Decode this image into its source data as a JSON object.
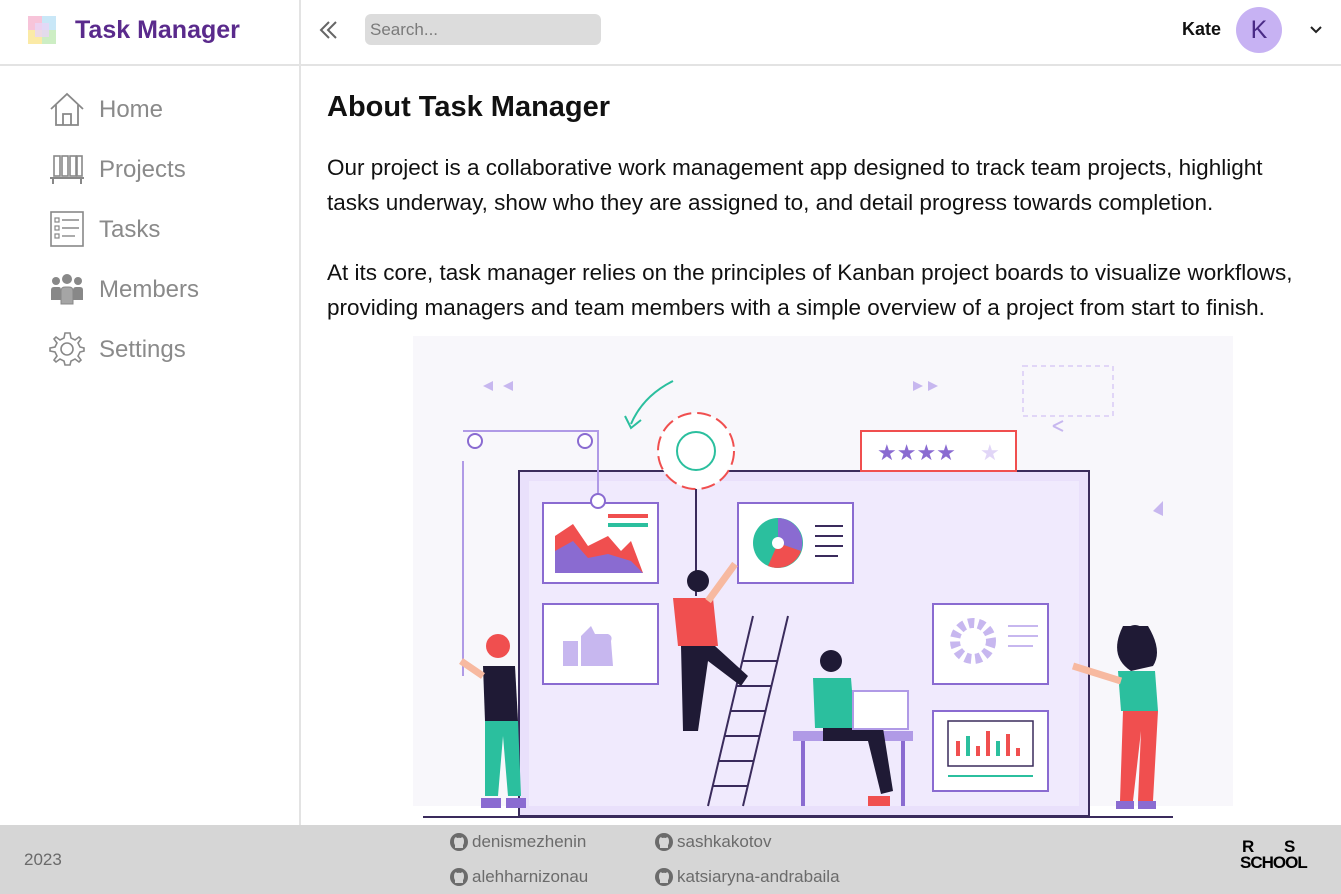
{
  "header": {
    "app_title": "Task Manager",
    "search_placeholder": "Search...",
    "user_name": "Kate",
    "avatar_letter": "K",
    "avatar_color": "#c7b2f3",
    "brand_color": "#5a2a8c"
  },
  "sidebar": {
    "items": [
      {
        "label": "Home",
        "icon": "home-icon"
      },
      {
        "label": "Projects",
        "icon": "projects-icon"
      },
      {
        "label": "Tasks",
        "icon": "tasks-icon"
      },
      {
        "label": "Members",
        "icon": "members-icon"
      },
      {
        "label": "Settings",
        "icon": "gear-icon"
      }
    ]
  },
  "main": {
    "title": "About Task Manager",
    "paragraph_1": "Our project is a collaborative work management app designed to track team projects, highlight tasks underway, show who they are assigned to, and detail progress towards completion.",
    "paragraph_2": "At its core, task manager relies on the principles of Kanban project boards to visualize workflows, providing managers and team members with a simple overview of a project from start to finish.",
    "illustration": "kanban-team-illustration"
  },
  "footer": {
    "year": "2023",
    "contributors": [
      "denismezhenin",
      "sashkakotov",
      "alehharnizonau",
      "katsiaryna-andrabaila"
    ],
    "school_logo": {
      "line1_left": "R",
      "line1_right": "S",
      "line2": "SCHOOL"
    }
  }
}
